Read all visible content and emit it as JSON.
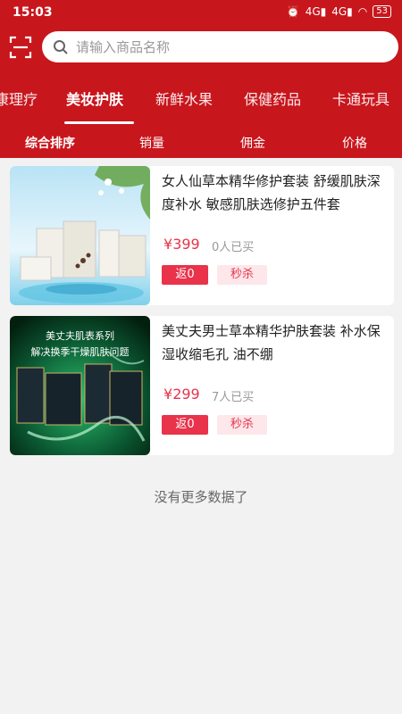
{
  "status_bar": {
    "time": "15:03",
    "signal1": "4G",
    "signal2": "4G",
    "battery": "53"
  },
  "search": {
    "placeholder": "请输入商品名称"
  },
  "tabs": [
    {
      "label": "康理疗"
    },
    {
      "label": "美妆护肤"
    },
    {
      "label": "新鲜水果"
    },
    {
      "label": "保健药品"
    },
    {
      "label": "卡通玩具"
    }
  ],
  "active_tab": "美妆护肤",
  "sort": [
    {
      "label": "综合排序"
    },
    {
      "label": "销量"
    },
    {
      "label": "佣金"
    },
    {
      "label": "价格"
    }
  ],
  "products": [
    {
      "title": "女人仙草本精华修护套装 舒缓肌肤深度补水 敏感肌肤选修护五件套",
      "currency": "¥",
      "price": "399",
      "sold": "0人已买",
      "rebate": "返0",
      "flash": "秒杀"
    },
    {
      "title": "美丈夫男士草本精华护肤套装 补水保湿收缩毛孔 油不绷",
      "currency": "¥",
      "price": "299",
      "sold": "7人已买",
      "rebate": "返0",
      "flash": "秒杀",
      "image_text": [
        "美丈夫肌表系列",
        "解决换季干燥肌肤问题"
      ]
    }
  ],
  "no_more": "没有更多数据了",
  "colors": {
    "brand_red": "#c8161d",
    "price_red": "#e8334b",
    "background": "#f2f2f2"
  }
}
